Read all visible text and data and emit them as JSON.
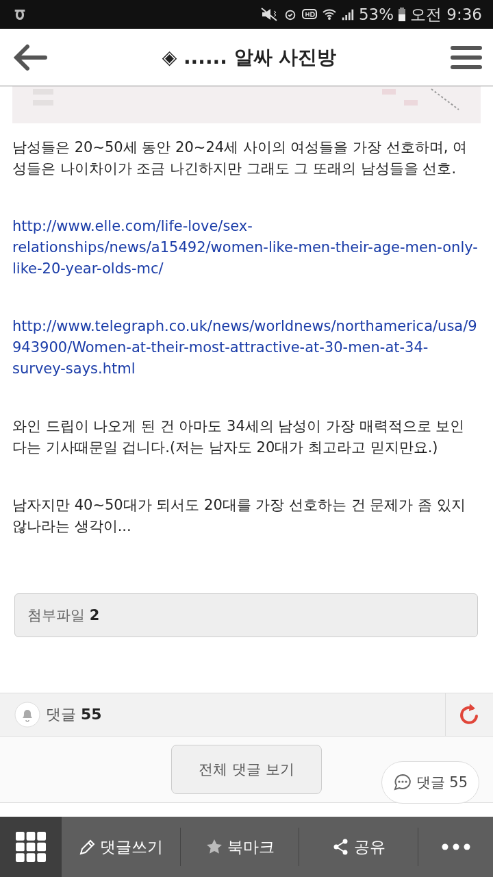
{
  "status_bar": {
    "battery": "53%",
    "time": "오전 9:36"
  },
  "header": {
    "title": "◈ ...... 알싸 사진방"
  },
  "post": {
    "paragraphs": [
      {
        "kind": "text",
        "text": "남성들은 20~50세 동안 20~24세 사이의 여성들을 가장 선호하며, 여성들은 나이차이가 조금 나긴하지만 그래도 그 또래의 남성들을 선호."
      },
      {
        "kind": "link",
        "text": "http://www.elle.com/life-love/sex-relationships/news/a15492/women-like-men-their-age-men-only-like-20-year-olds-mc/"
      },
      {
        "kind": "link",
        "text": "http://www.telegraph.co.uk/news/worldnews/northamerica/usa/9943900/Women-at-their-most-attractive-at-30-men-at-34-survey-says.html"
      },
      {
        "kind": "text",
        "text": "와인 드립이 나오게 된 건 아마도 34세의 남성이 가장 매력적으로 보인다는 기사때문일 겁니다.(저는 남자도 20대가 최고라고 믿지만요.)"
      },
      {
        "kind": "text",
        "text": "남자지만 40~50대가 되서도 20대를 가장 선호하는 건 문제가 좀 있지 않나라는 생각이..."
      }
    ],
    "attachments": {
      "label": "첨부파일",
      "count": "2"
    }
  },
  "comments": {
    "label": "댓글",
    "count": "55",
    "view_all": "전체 댓글 보기",
    "float_label": "댓글 55"
  },
  "toolbar": [
    {
      "kind": "write",
      "label": "댓글쓰기"
    },
    {
      "kind": "bookmark",
      "label": "북마크"
    },
    {
      "kind": "share",
      "label": "공유"
    },
    {
      "kind": "more"
    }
  ]
}
